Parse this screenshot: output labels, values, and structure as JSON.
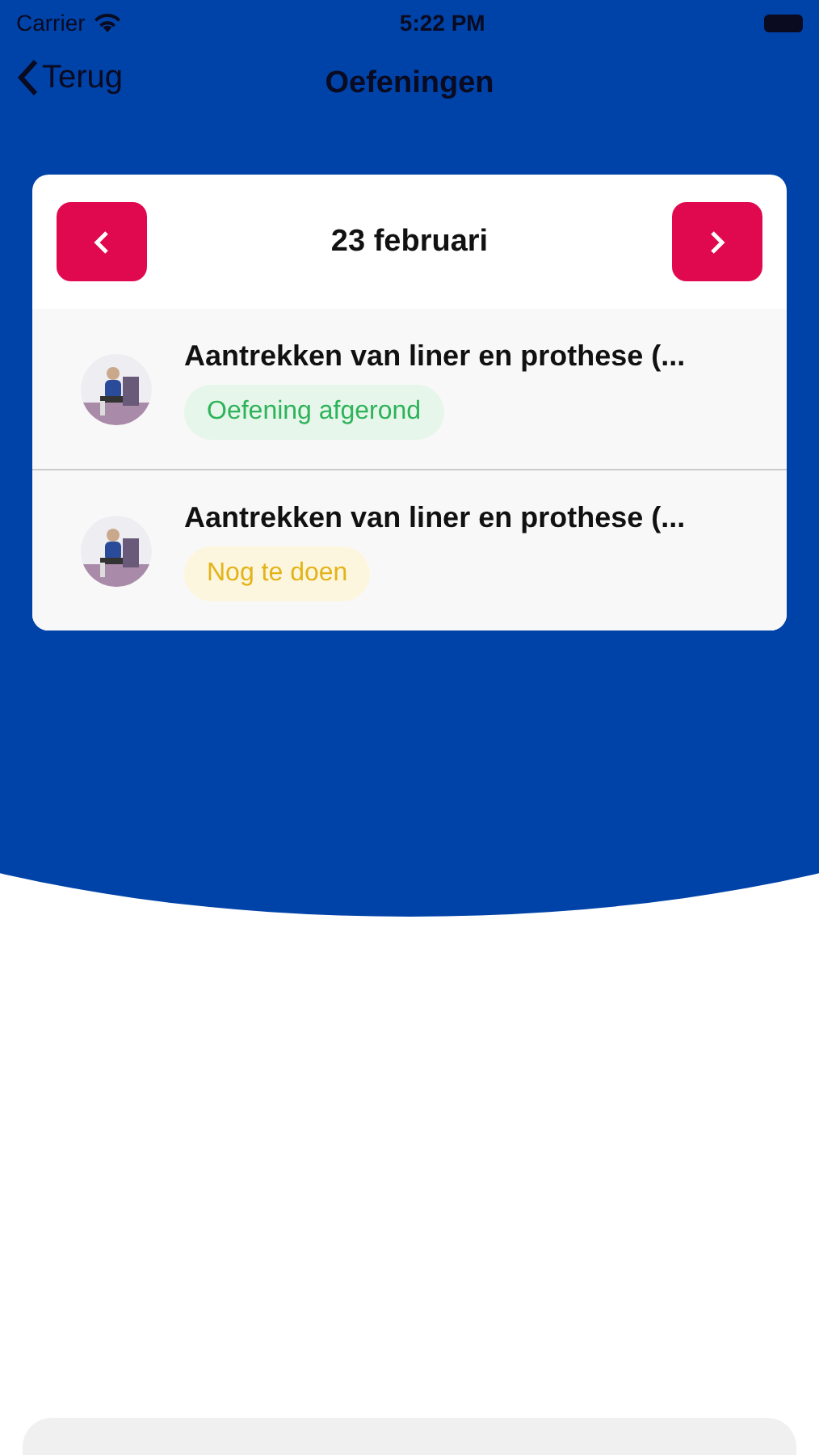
{
  "status_bar": {
    "carrier": "Carrier",
    "time": "5:22 PM"
  },
  "nav": {
    "back_label": "Terug",
    "title": "Oefeningen"
  },
  "day_card": {
    "date": "23 februari",
    "exercises": [
      {
        "title": "Aantrekken van liner en prothese (...",
        "status": "Oefening afgerond",
        "kind": "done"
      },
      {
        "title": "Aantrekken van liner en prothese (...",
        "status": "Nog te doen",
        "kind": "todo"
      }
    ]
  }
}
